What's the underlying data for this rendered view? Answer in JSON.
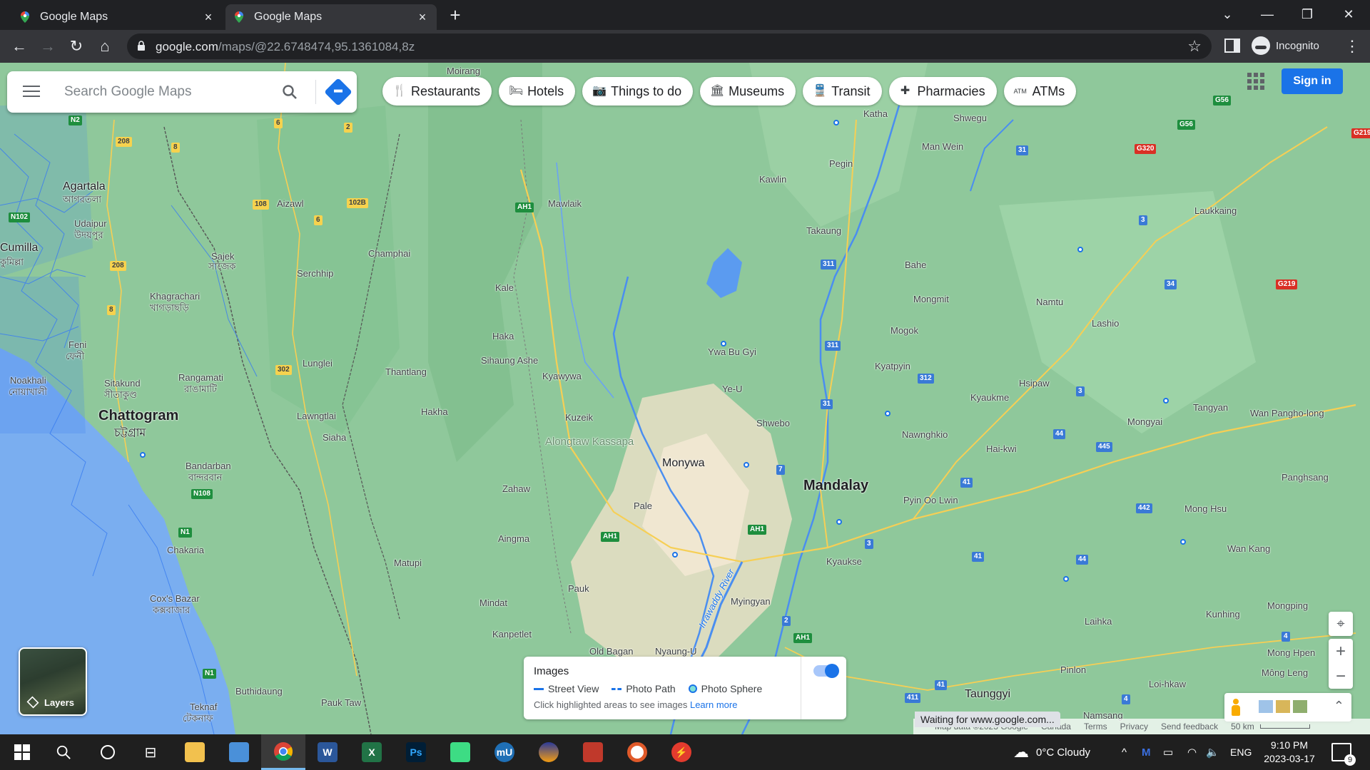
{
  "browser": {
    "tabs": [
      {
        "title": "Google Maps",
        "active": false
      },
      {
        "title": "Google Maps",
        "active": true
      }
    ],
    "url_host": "google.com",
    "url_path": "/maps/@22.6748474,95.1361084,8z",
    "profile_label": "Incognito"
  },
  "search": {
    "placeholder": "Search Google Maps"
  },
  "chips": [
    {
      "label": "Restaurants",
      "icon": "utensils-icon"
    },
    {
      "label": "Hotels",
      "icon": "bed-icon"
    },
    {
      "label": "Things to do",
      "icon": "camera-icon"
    },
    {
      "label": "Museums",
      "icon": "museum-icon"
    },
    {
      "label": "Transit",
      "icon": "train-icon"
    },
    {
      "label": "Pharmacies",
      "icon": "pharmacy-icon"
    },
    {
      "label": "ATMs",
      "icon": "atm-icon"
    }
  ],
  "signin_label": "Sign in",
  "layers_label": "Layers",
  "images_panel": {
    "title": "Images",
    "legend": [
      "Street View",
      "Photo Path",
      "Photo Sphere"
    ],
    "note": "Click highlighted areas to see images",
    "learn_more": "Learn more"
  },
  "map_footer": {
    "data": "Map data ©2023 Google",
    "country": "Canada",
    "terms": "Terms",
    "privacy": "Privacy",
    "feedback": "Send feedback",
    "scale": "50 km"
  },
  "status_text": "Waiting for www.google.com...",
  "map_labels": {
    "agartala": "Agartala",
    "agartala_local": "আগরতলা",
    "udaipur": "Udaipur",
    "udaipur_local": "উদয়পুর",
    "cumilla": "Cumilla",
    "cumilla_local": "কুমিল্লা",
    "aizawl": "Aizawl",
    "champhai": "Champhai",
    "serchhip": "Serchhip",
    "sajek": "Sajek",
    "sajek_local": "সাজেক",
    "khagrachari": "Khagrachari",
    "khagrachari_local": "খাগড়াছড়ি",
    "feni": "Feni",
    "feni_local": "ফেনী",
    "rangamati": "Rangamati",
    "rangamati_local": "রাঙামাটি",
    "lunglei": "Lunglei",
    "thantlang": "Thantlang",
    "noakhali": "Noakhali",
    "noakhali_local": "নোয়াখালী",
    "sitakund": "Sitakund",
    "sitakund_local": "সীতাকুণ্ড",
    "chattogram": "Chattogram",
    "chattogram_local": "চট্টগ্রাম",
    "lawngtlai": "Lawngtlai",
    "siaha": "Siaha",
    "hakha": "Hakha",
    "bandarban": "Bandarban",
    "bandarban_local": "বান্দরবান",
    "chakaria": "Chakaria",
    "coxs_bazar": "Cox's Bazar",
    "coxs_bazar_local": "কক্সবাজার",
    "teknaf": "Teknaf",
    "teknaf_local": "টেকনাফ",
    "buthidaung": "Buthidaung",
    "pauk_taw": "Pauk Taw",
    "matupi": "Matupi",
    "aingma": "Aingma",
    "zahaw": "Zahaw",
    "mindat": "Mindat",
    "kanpetlet": "Kanpetlet",
    "moirang": "Moirang",
    "mawlaik": "Mawlaik",
    "kale": "Kale",
    "haka": "Haka",
    "sihaung_ashe": "Sihaung Ashe",
    "kyawywa": "Kyawywa",
    "kuzeik": "Kuzeik",
    "alongtaw_kassapa": "Alongtaw Kassapa",
    "monywa": "Monywa",
    "pale": "Pale",
    "pauk": "Pauk",
    "old_bagan": "Old Bagan",
    "nyaung_u": "Nyaung-U",
    "myingyan": "Myingyan",
    "irrawaddy": "Irrawaddy River",
    "kawlin": "Kawlin",
    "pegin": "Pegin",
    "katha": "Katha",
    "takaung": "Takaung",
    "ywa_bu_gyi": "Ywa Bu Gyi",
    "ye_u": "Ye-U",
    "shwebo": "Shwebo",
    "mandalay": "Mandalay",
    "kyaukse": "Kyaukse",
    "pyin_oo_lwin": "Pyin Oo Lwin",
    "bahe": "Bahe",
    "mongmit": "Mongmit",
    "mogok": "Mogok",
    "kyatpyin": "Kyatpyin",
    "nawnghkio": "Nawnghkio",
    "kyaukme": "Kyaukme",
    "hsipaw": "Hsipaw",
    "hai_kwi": "Hai-kwi",
    "namtu": "Namtu",
    "lashio": "Lashio",
    "shwegu": "Shwegu",
    "man_wein": "Man Wein",
    "laukkaing": "Laukkaing",
    "tangyan": "Tangyan",
    "mongyai": "Mongyai",
    "wan_pangho_long": "Wan Pangho-long",
    "panghsang": "Panghsang",
    "mong_hsu": "Mong Hsu",
    "wan_kang": "Wan Kang",
    "kunhing": "Kunhing",
    "laihka": "Laihka",
    "pinlon": "Pinlon",
    "loi_hkaw": "Loi-hkaw",
    "taunggyi": "Taunggyi",
    "namsang": "Namsang",
    "mongping": "Mongping",
    "mong_hpen": "Mong Hpen",
    "mong_leng": "Mông Leng"
  },
  "taskbar": {
    "weather": "0°C  Cloudy",
    "lang": "ENG",
    "time": "9:10 PM",
    "date": "2023-03-17",
    "notifications": "9"
  },
  "colors": {
    "map_green": "#8fc89b",
    "water": "#7aaef0",
    "accent": "#1a73e8",
    "chrome_dark": "#202124"
  }
}
